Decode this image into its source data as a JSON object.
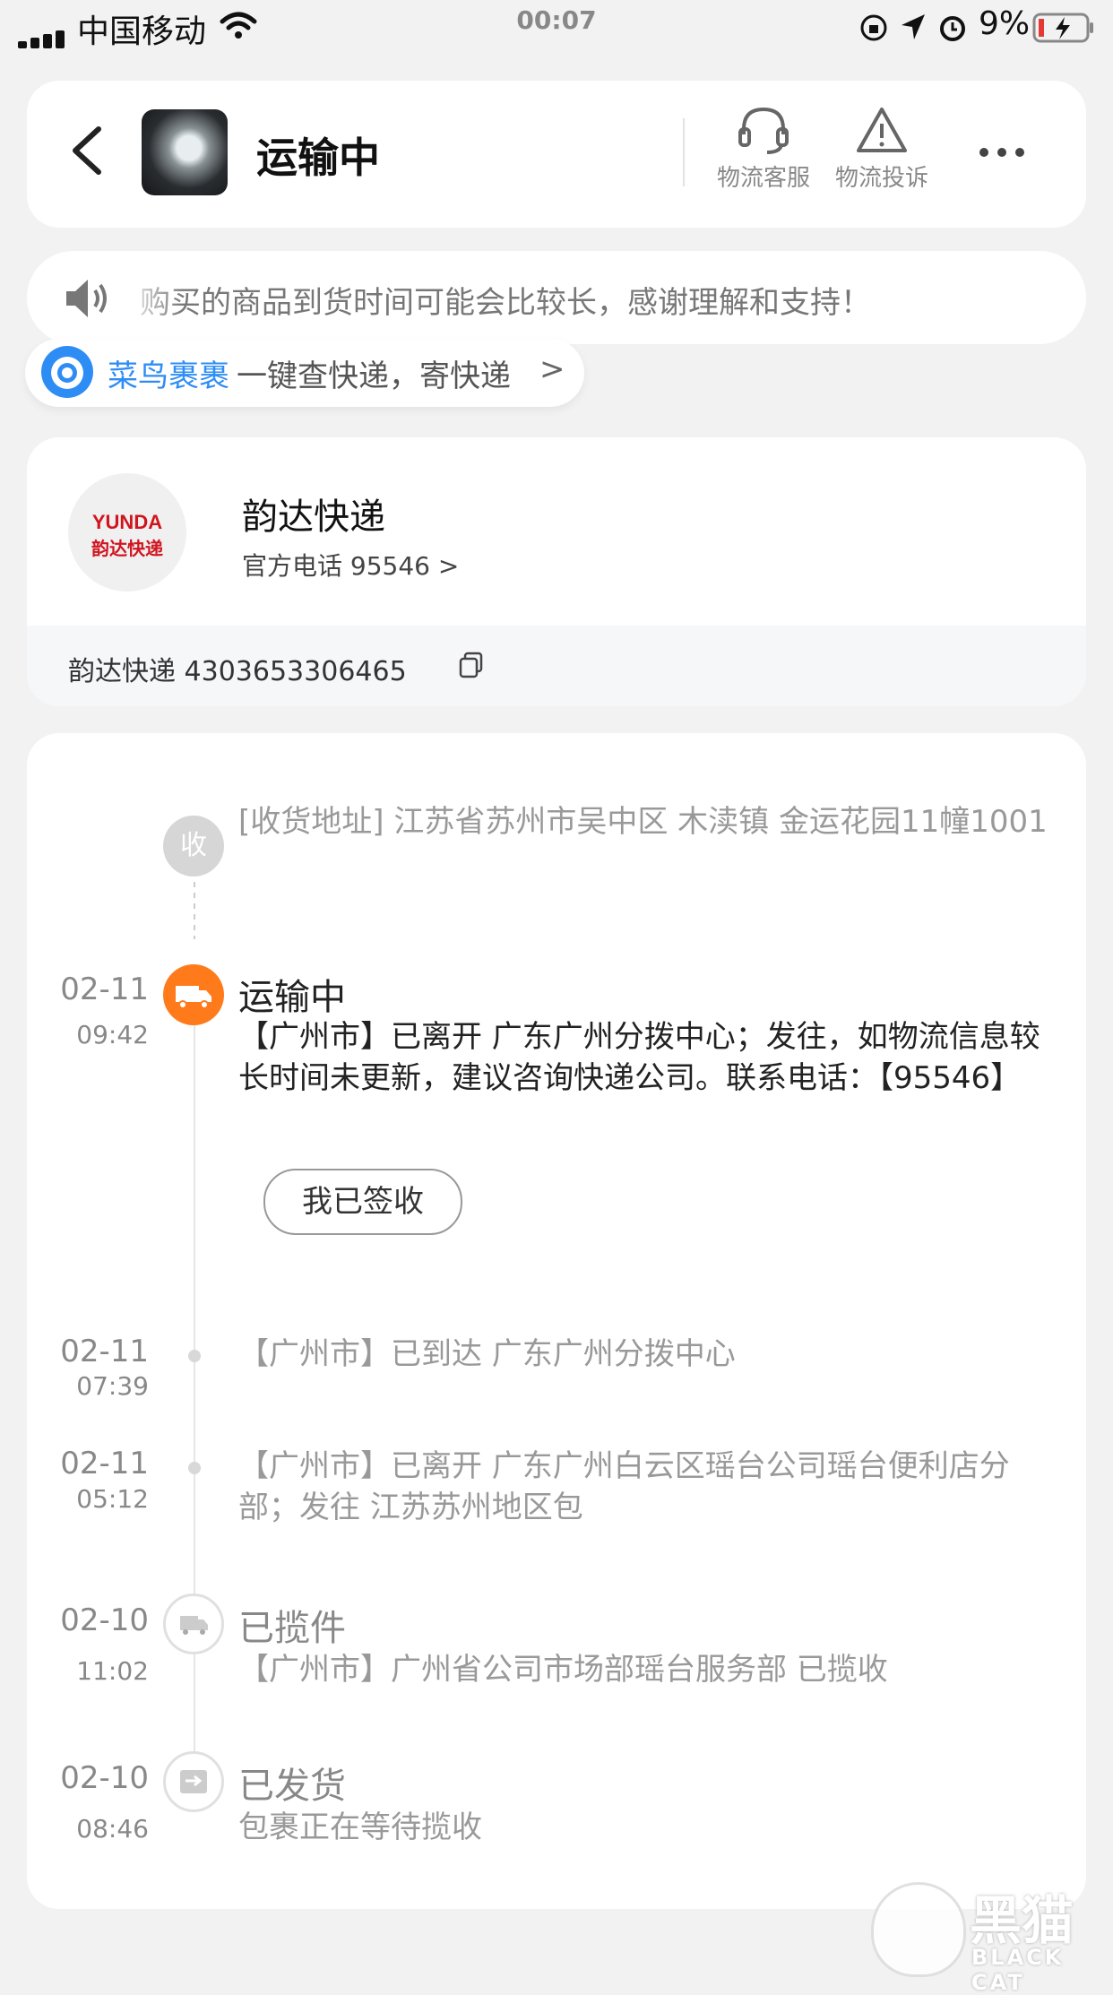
{
  "status_bar": {
    "carrier": "中国移动",
    "time": "00:07",
    "battery": "9%"
  },
  "header": {
    "title": "运输中",
    "actions": [
      {
        "label": "物流客服",
        "icon": "headset-icon"
      },
      {
        "label": "物流投诉",
        "icon": "warning-icon"
      }
    ]
  },
  "notice": {
    "text": "购买的商品到货时间可能会比较长，感谢理解和支持！"
  },
  "cainiao": {
    "brand": "菜鸟裹裹",
    "text": "一键查快递，寄快递",
    "chevron": ">"
  },
  "courier": {
    "logo_text": "YUNDA",
    "logo_cn": "韵达快递",
    "name": "韵达快递",
    "phone": "官方电话 95546 >",
    "tracking": "韵达快递 4303653306465"
  },
  "timeline": {
    "address_node": "收",
    "address": "[收货地址] 江苏省苏州市吴中区 木渎镇  金运花园11幢1001",
    "events": [
      {
        "date": "02-11",
        "time": "09:42",
        "title": "运输中",
        "desc": "【广州市】已离开 广东广州分拨中心；发往，如物流信息较长时间未更新，建议咨询快递公司。联系电话：【95546】"
      },
      {
        "date": "02-11",
        "time": "07:39",
        "title": "",
        "desc": "【广州市】已到达 广东广州分拨中心"
      },
      {
        "date": "02-11",
        "time": "05:12",
        "title": "",
        "desc": "【广州市】已离开 广东广州白云区瑶台公司瑶台便利店分部；发往 江苏苏州地区包"
      },
      {
        "date": "02-10",
        "time": "11:02",
        "title": "已揽件",
        "desc": "【广州市】广州省公司市场部瑶台服务部 已揽收"
      },
      {
        "date": "02-10",
        "time": "08:46",
        "title": "已发货",
        "desc": "包裹正在等待揽收"
      }
    ],
    "sign_button": "我已签收"
  },
  "watermark": {
    "cn": "黑猫",
    "en": "BLACK CAT"
  }
}
